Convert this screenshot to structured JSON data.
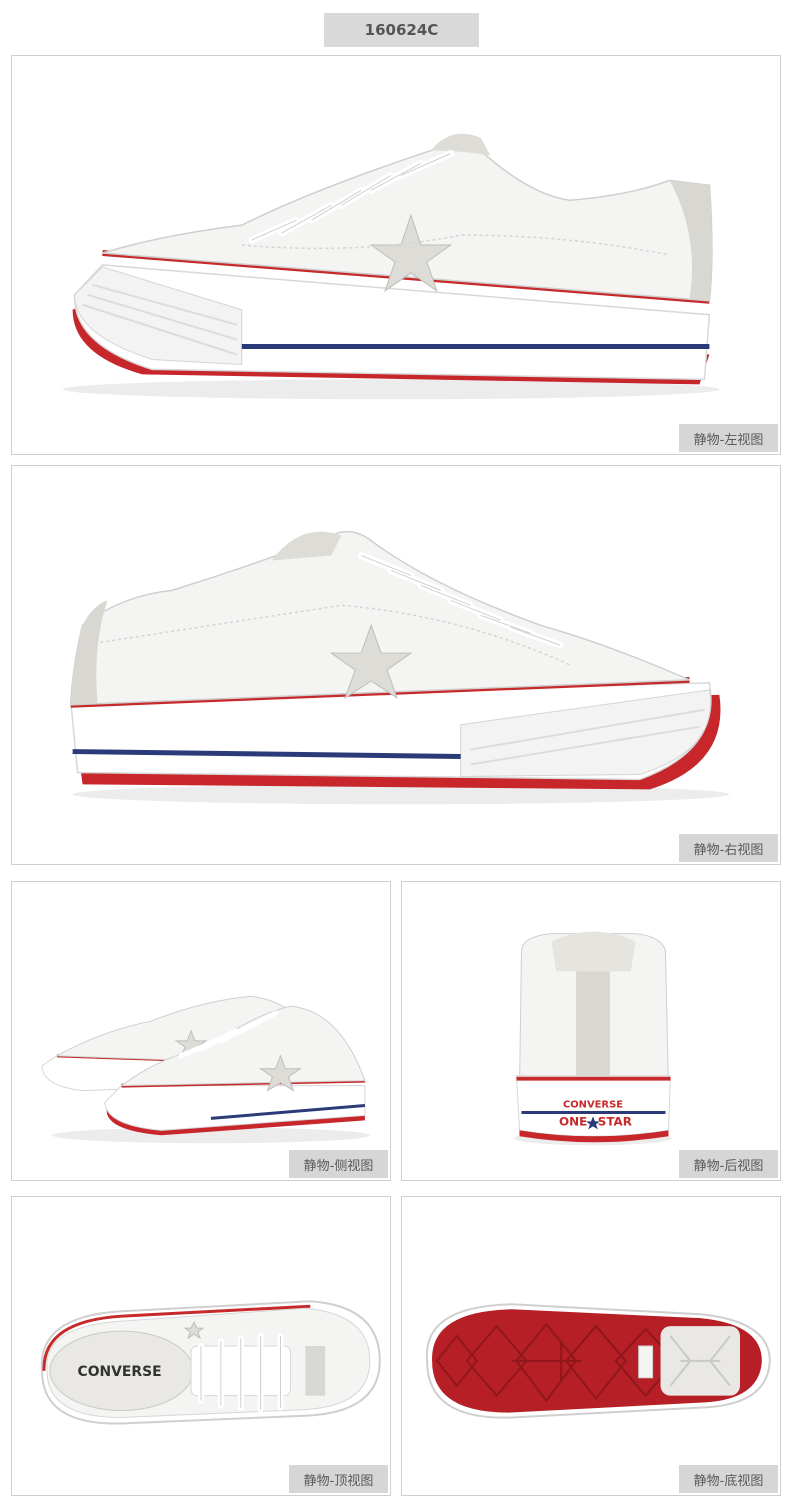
{
  "header": {
    "sku": "160624C"
  },
  "product": {
    "brand_text": "CONVERSE",
    "sub_brand_left": "ONE",
    "sub_brand_right": "STAR",
    "colors": {
      "leather": "#f4f4f2",
      "accent_red": "#c62a2a",
      "accent_blue": "#2b3a78",
      "suede": "#d9d7d2",
      "sole": "#ffffff",
      "outsole": "#b51f25"
    }
  },
  "views": [
    {
      "id": "left",
      "caption": "静物-左视图"
    },
    {
      "id": "right",
      "caption": "静物-右视图"
    },
    {
      "id": "side",
      "caption": "静物-侧视图"
    },
    {
      "id": "back",
      "caption": "静物-后视图"
    },
    {
      "id": "top",
      "caption": "静物-顶视图"
    },
    {
      "id": "bottom",
      "caption": "静物-底视图"
    }
  ]
}
